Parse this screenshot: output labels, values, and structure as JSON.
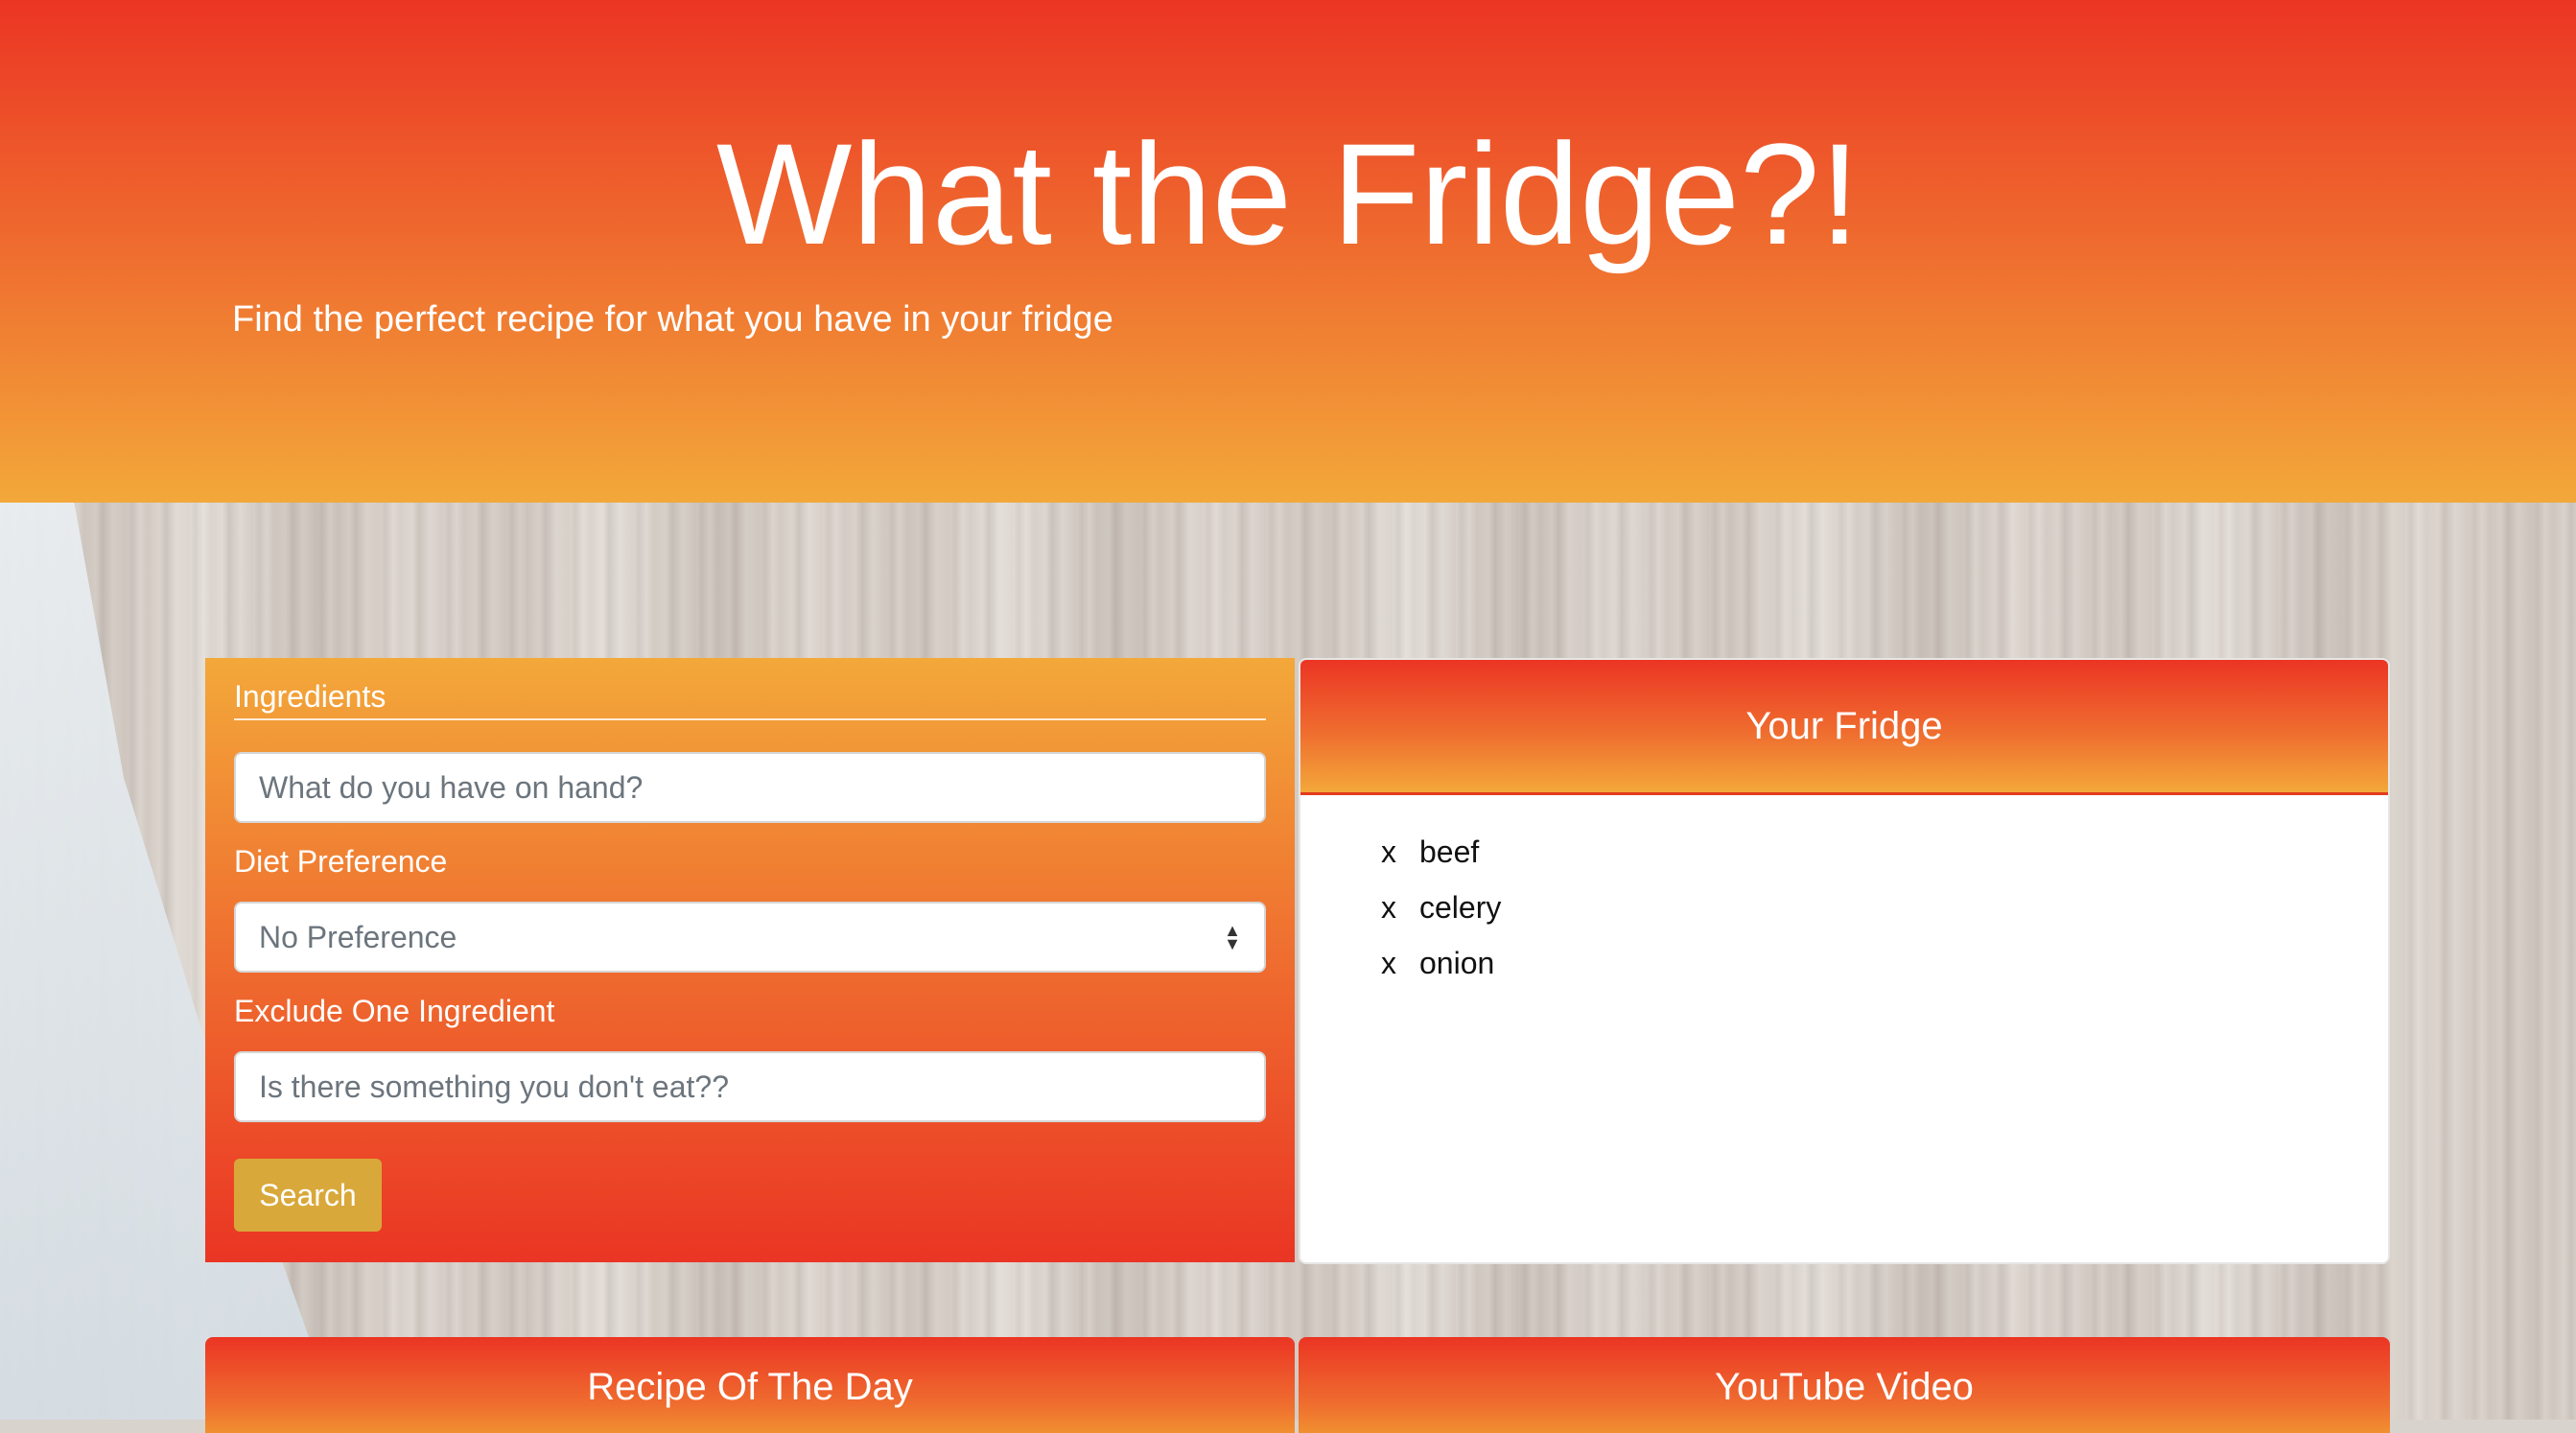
{
  "header": {
    "title": "What the Fridge?!",
    "tagline": "Find the perfect recipe for what you have in your fridge"
  },
  "form": {
    "ingredients_label": "Ingredients",
    "ingredients_placeholder": "What do you have on hand?",
    "diet_label": "Diet Preference",
    "diet_selected": "No Preference",
    "exclude_label": "Exclude One Ingredient",
    "exclude_placeholder": "Is there something you don't eat??",
    "search_label": "Search"
  },
  "fridge": {
    "title": "Your Fridge",
    "remove_symbol": "x",
    "items": [
      {
        "name": "beef"
      },
      {
        "name": "celery"
      },
      {
        "name": "onion"
      }
    ]
  },
  "recipe_of_the_day": {
    "title": "Recipe Of The Day"
  },
  "youtube": {
    "title": "YouTube Video"
  },
  "colors": {
    "header_top": "#eb3524",
    "header_bottom": "#f3a83a",
    "search_button": "#d9a83a"
  }
}
